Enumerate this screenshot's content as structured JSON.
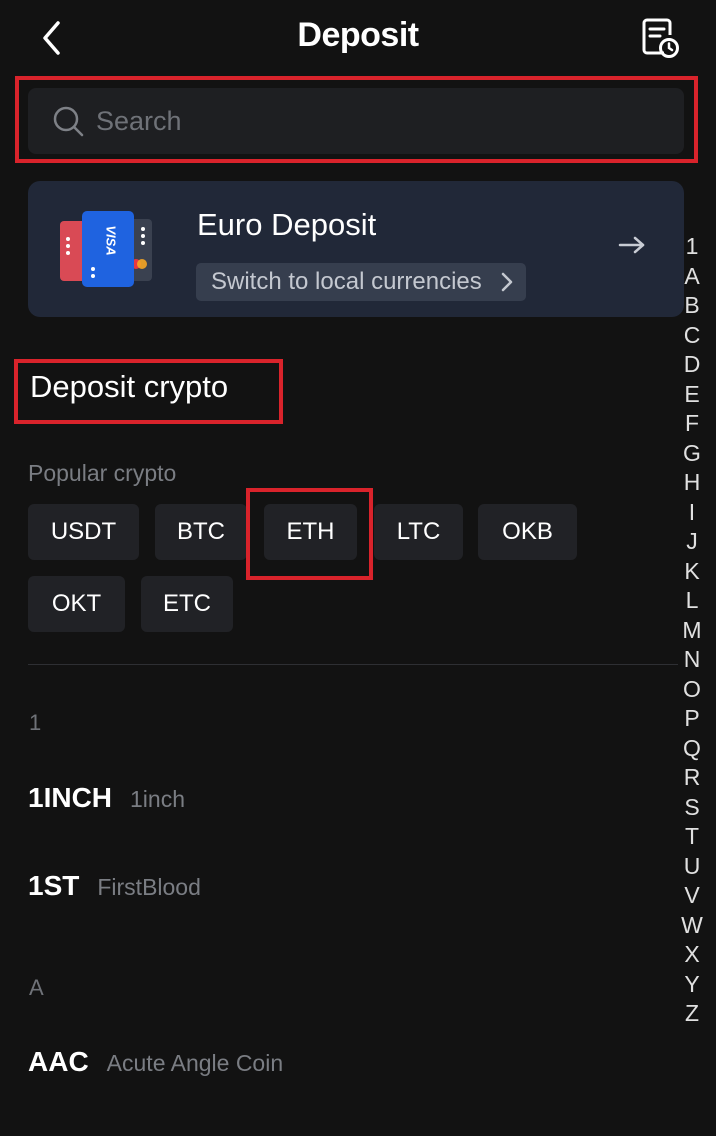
{
  "header": {
    "title": "Deposit"
  },
  "search": {
    "placeholder": "Search",
    "value": ""
  },
  "euro_card": {
    "title": "Euro Deposit",
    "switch_label": "Switch to local currencies",
    "card_brand": "VISA"
  },
  "section": {
    "title": "Deposit crypto",
    "popular_label": "Popular crypto",
    "popular": [
      "USDT",
      "BTC",
      "ETH",
      "LTC",
      "OKB",
      "OKT",
      "ETC"
    ]
  },
  "list": {
    "groups": [
      {
        "letter": "1",
        "items": [
          {
            "symbol": "1INCH",
            "name": "1inch"
          },
          {
            "symbol": "1ST",
            "name": "FirstBlood"
          }
        ]
      },
      {
        "letter": "A",
        "items": [
          {
            "symbol": "AAC",
            "name": "Acute Angle Coin"
          }
        ]
      }
    ]
  },
  "alpha_index": [
    "1",
    "A",
    "B",
    "C",
    "D",
    "E",
    "F",
    "G",
    "H",
    "I",
    "J",
    "K",
    "L",
    "M",
    "N",
    "O",
    "P",
    "Q",
    "R",
    "S",
    "T",
    "U",
    "V",
    "W",
    "X",
    "Y",
    "Z"
  ],
  "icons": {
    "back": "chevron-left-icon",
    "history": "document-clock-icon",
    "search": "search-icon",
    "arrow": "arrow-right-icon",
    "chevron": "chevron-right-icon"
  },
  "colors": {
    "background": "#121212",
    "card": "#212838",
    "chip": "#212226",
    "highlight": "#d9232b",
    "visa_blue": "#1f63e0"
  }
}
